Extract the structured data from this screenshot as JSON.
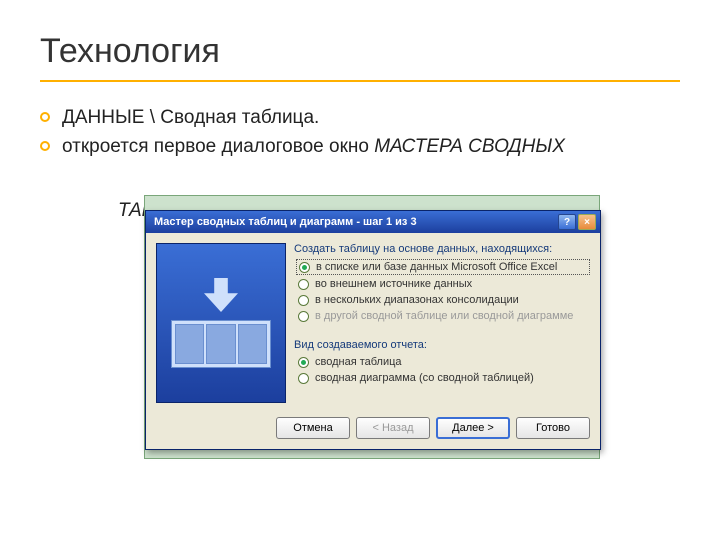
{
  "slide": {
    "title": "Технология",
    "bullet1": "ДАННЫЕ \\ Сводная таблица.",
    "bullet2_plain": "откроется первое диалоговое окно ",
    "bullet2_italic": "МАСТЕРА СВОДНЫХ",
    "bullet2_rest": "ТАБ"
  },
  "wizard": {
    "title": "Мастер сводных таблиц и диаграмм - шаг 1 из 3",
    "help_label": "?",
    "close_label": "×",
    "group1_label": "Создать таблицу на основе данных, находящихся:",
    "opt1": "в списке или базе данных Microsoft Office Excel",
    "opt2": "во внешнем источнике данных",
    "opt3": "в нескольких диапазонах консолидации",
    "opt4": "в другой сводной таблице или сводной диаграмме",
    "group2_label": "Вид создаваемого отчета:",
    "opt5": "сводная таблица",
    "opt6": "сводная диаграмма (со сводной таблицей)",
    "btn_cancel": "Отмена",
    "btn_back": "< Назад",
    "btn_next": "Далее >",
    "btn_finish": "Готово"
  }
}
